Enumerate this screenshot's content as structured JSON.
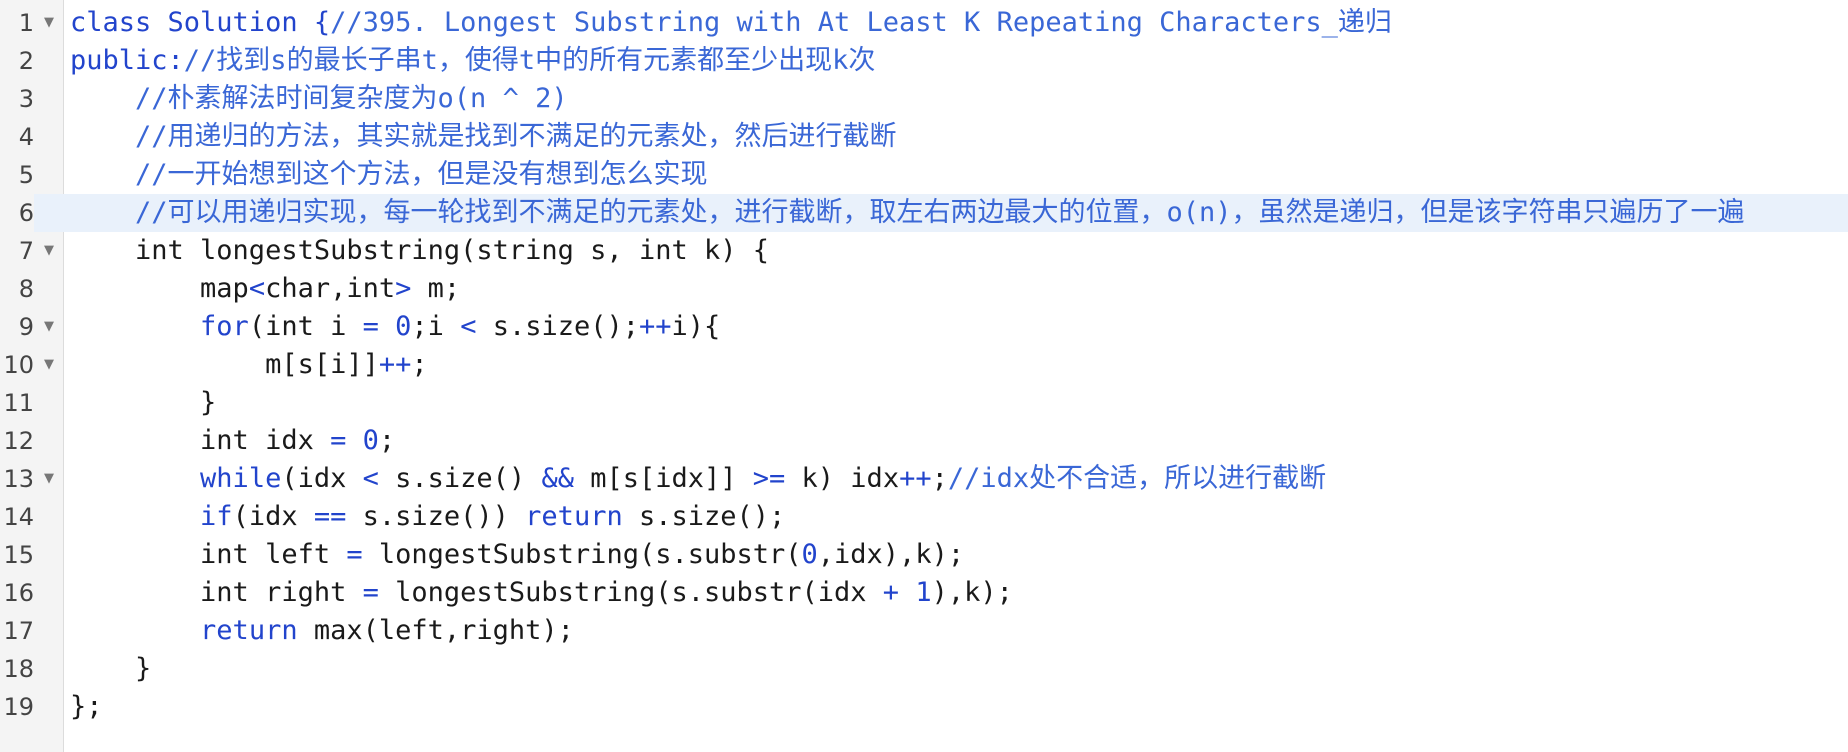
{
  "editor": {
    "lines": [
      {
        "no": "1",
        "fold": true,
        "active": false,
        "segments": [
          {
            "t": "class Solution {",
            "c": "kw"
          },
          {
            "t": "//395. Longest Substring with At Least K Repeating Characters_递归",
            "c": "cm"
          }
        ]
      },
      {
        "no": "2",
        "fold": false,
        "active": false,
        "segments": [
          {
            "t": "public:",
            "c": "kw"
          },
          {
            "t": "//找到s的最长子串t，使得t中的所有元素都至少出现k次",
            "c": "cm"
          }
        ]
      },
      {
        "no": "3",
        "fold": false,
        "active": false,
        "segments": [
          {
            "t": "    ",
            "c": ""
          },
          {
            "t": "//朴素解法时间复杂度为o(n ^ 2)",
            "c": "cm"
          }
        ]
      },
      {
        "no": "4",
        "fold": false,
        "active": false,
        "segments": [
          {
            "t": "    ",
            "c": ""
          },
          {
            "t": "//用递归的方法，其实就是找到不满足的元素处，然后进行截断",
            "c": "cm"
          }
        ]
      },
      {
        "no": "5",
        "fold": false,
        "active": false,
        "segments": [
          {
            "t": "    ",
            "c": ""
          },
          {
            "t": "//一开始想到这个方法，但是没有想到怎么实现",
            "c": "cm"
          }
        ]
      },
      {
        "no": "6",
        "fold": false,
        "active": true,
        "segments": [
          {
            "t": "    ",
            "c": ""
          },
          {
            "t": "//可以用递归实现，每一轮找到不满足的元素处，进行截断，取左右两边最大的位置，o(n)，虽然是递归，但是该字符串只遍历了一遍",
            "c": "cm"
          }
        ]
      },
      {
        "no": "7",
        "fold": true,
        "active": false,
        "segments": [
          {
            "t": "    int longestSubstring(string s, int k) {",
            "c": ""
          }
        ]
      },
      {
        "no": "8",
        "fold": false,
        "active": false,
        "segments": [
          {
            "t": "        map",
            "c": ""
          },
          {
            "t": "<",
            "c": "op"
          },
          {
            "t": "char,int",
            "c": ""
          },
          {
            "t": ">",
            "c": "op"
          },
          {
            "t": " m;",
            "c": ""
          }
        ]
      },
      {
        "no": "9",
        "fold": true,
        "active": false,
        "segments": [
          {
            "t": "        ",
            "c": ""
          },
          {
            "t": "for",
            "c": "kw"
          },
          {
            "t": "(int i ",
            "c": ""
          },
          {
            "t": "=",
            "c": "op"
          },
          {
            "t": " ",
            "c": ""
          },
          {
            "t": "0",
            "c": "num"
          },
          {
            "t": ";i ",
            "c": ""
          },
          {
            "t": "<",
            "c": "op"
          },
          {
            "t": " s.size();",
            "c": ""
          },
          {
            "t": "++",
            "c": "op"
          },
          {
            "t": "i){",
            "c": ""
          }
        ]
      },
      {
        "no": "10",
        "fold": true,
        "active": false,
        "segments": [
          {
            "t": "            m[s[i]]",
            "c": ""
          },
          {
            "t": "++",
            "c": "op"
          },
          {
            "t": ";",
            "c": ""
          }
        ]
      },
      {
        "no": "11",
        "fold": false,
        "active": false,
        "segments": [
          {
            "t": "        }",
            "c": ""
          }
        ]
      },
      {
        "no": "12",
        "fold": false,
        "active": false,
        "segments": [
          {
            "t": "        int idx ",
            "c": ""
          },
          {
            "t": "=",
            "c": "op"
          },
          {
            "t": " ",
            "c": ""
          },
          {
            "t": "0",
            "c": "num"
          },
          {
            "t": ";",
            "c": ""
          }
        ]
      },
      {
        "no": "13",
        "fold": true,
        "active": false,
        "segments": [
          {
            "t": "        ",
            "c": ""
          },
          {
            "t": "while",
            "c": "kw"
          },
          {
            "t": "(idx ",
            "c": ""
          },
          {
            "t": "<",
            "c": "op"
          },
          {
            "t": " s.size() ",
            "c": ""
          },
          {
            "t": "&&",
            "c": "op"
          },
          {
            "t": " m[s[idx]] ",
            "c": ""
          },
          {
            "t": ">=",
            "c": "op"
          },
          {
            "t": " k) idx",
            "c": ""
          },
          {
            "t": "++",
            "c": "op"
          },
          {
            "t": ";",
            "c": ""
          },
          {
            "t": "//idx处不合适，所以进行截断",
            "c": "cm"
          }
        ]
      },
      {
        "no": "14",
        "fold": false,
        "active": false,
        "segments": [
          {
            "t": "        ",
            "c": ""
          },
          {
            "t": "if",
            "c": "kw"
          },
          {
            "t": "(idx ",
            "c": ""
          },
          {
            "t": "==",
            "c": "op"
          },
          {
            "t": " s.size()) ",
            "c": ""
          },
          {
            "t": "return",
            "c": "kw"
          },
          {
            "t": " s.size();",
            "c": ""
          }
        ]
      },
      {
        "no": "15",
        "fold": false,
        "active": false,
        "segments": [
          {
            "t": "        int left ",
            "c": ""
          },
          {
            "t": "=",
            "c": "op"
          },
          {
            "t": " longestSubstring(s.substr(",
            "c": ""
          },
          {
            "t": "0",
            "c": "num"
          },
          {
            "t": ",idx),k);",
            "c": ""
          }
        ]
      },
      {
        "no": "16",
        "fold": false,
        "active": false,
        "segments": [
          {
            "t": "        int right ",
            "c": ""
          },
          {
            "t": "=",
            "c": "op"
          },
          {
            "t": " longestSubstring(s.substr(idx ",
            "c": ""
          },
          {
            "t": "+",
            "c": "op"
          },
          {
            "t": " ",
            "c": ""
          },
          {
            "t": "1",
            "c": "num"
          },
          {
            "t": "),k);",
            "c": ""
          }
        ]
      },
      {
        "no": "17",
        "fold": false,
        "active": false,
        "segments": [
          {
            "t": "        ",
            "c": ""
          },
          {
            "t": "return",
            "c": "kw"
          },
          {
            "t": " max(left,right);",
            "c": ""
          }
        ]
      },
      {
        "no": "18",
        "fold": false,
        "active": false,
        "segments": [
          {
            "t": "    }",
            "c": ""
          }
        ]
      },
      {
        "no": "19",
        "fold": false,
        "active": false,
        "segments": [
          {
            "t": "};",
            "c": ""
          }
        ]
      }
    ]
  },
  "icons": {
    "fold": "fold-arrow-icon",
    "fold_glyph": "▼"
  }
}
